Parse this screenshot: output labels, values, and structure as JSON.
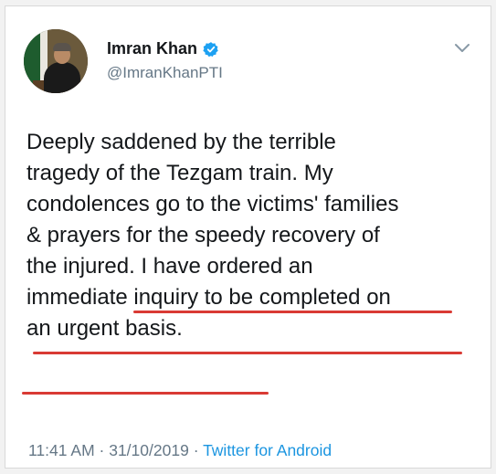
{
  "tweet": {
    "display_name": "Imran Khan",
    "handle": "@ImranKhanPTI",
    "verified": true,
    "text_lines": [
      "Deeply saddened by the terrible",
      "tragedy of the Tezgam train. My",
      "condolences go to the victims' families",
      "& prayers for the speedy recovery of",
      "the injured. I have ordered an",
      "immediate inquiry to be completed on",
      "an urgent basis."
    ],
    "time": "11:41 AM",
    "separator": "·",
    "date": "31/10/2019",
    "source": "Twitter for Android"
  },
  "colors": {
    "text": "#14171a",
    "secondary": "#657786",
    "link": "#1b95e0",
    "verified": "#1da1f2",
    "underline": "#d93a34"
  },
  "icons": {
    "verified": "verified-badge-icon",
    "menu": "chevron-down-icon"
  }
}
